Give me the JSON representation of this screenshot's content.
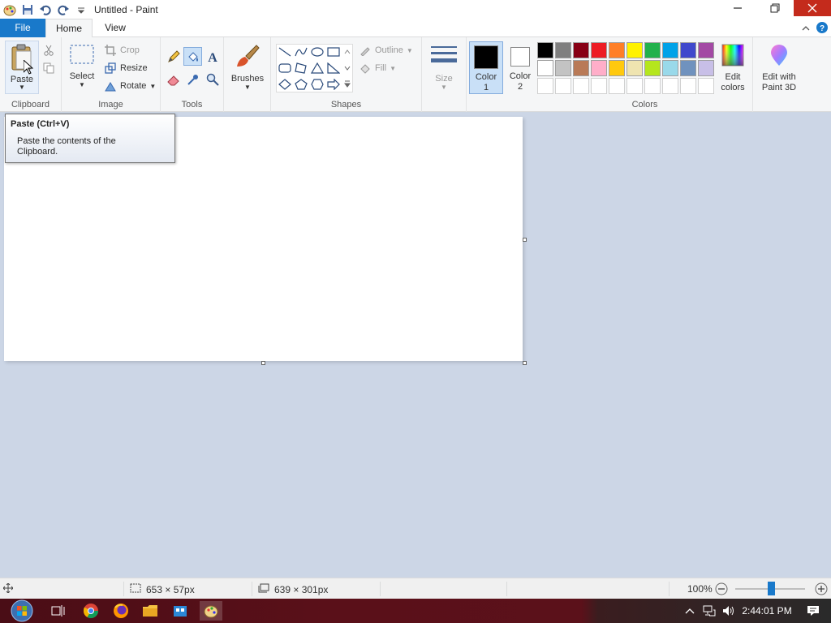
{
  "window": {
    "title": "Untitled - Paint"
  },
  "tabs": {
    "file": "File",
    "home": "Home",
    "view": "View"
  },
  "ribbon": {
    "clipboard": {
      "group_label": "Clipboard",
      "paste": "Paste"
    },
    "image": {
      "group_label": "Image",
      "select": "Select",
      "crop": "Crop",
      "resize": "Resize",
      "rotate": "Rotate"
    },
    "tools": {
      "group_label": "Tools"
    },
    "brushes": {
      "label": "Brushes"
    },
    "shapes": {
      "group_label": "Shapes",
      "outline": "Outline",
      "fill": "Fill"
    },
    "size": {
      "label": "Size"
    },
    "colors": {
      "group_label": "Colors",
      "color1_label": "Color",
      "color1_num": "1",
      "color2_label": "Color",
      "color2_num": "2",
      "color1_value": "#000000",
      "color2_value": "#ffffff",
      "edit_colors_line1": "Edit",
      "edit_colors_line2": "colors",
      "paint3d_line1": "Edit with",
      "paint3d_line2": "Paint 3D",
      "palette_row1": [
        "#000000",
        "#7f7f7f",
        "#880015",
        "#ed1c24",
        "#ff7f27",
        "#fff200",
        "#22b14c",
        "#00a2e8",
        "#3f48cc",
        "#a349a4"
      ],
      "palette_row2": [
        "#ffffff",
        "#c3c3c3",
        "#b97a57",
        "#ffaec9",
        "#ffc90e",
        "#efe4b0",
        "#b5e61d",
        "#99d9ea",
        "#7092be",
        "#c8bfe7"
      ]
    }
  },
  "tooltip": {
    "title": "Paste (Ctrl+V)",
    "desc_line1": "Paste the contents of the",
    "desc_line2": "Clipboard."
  },
  "statusbar": {
    "selection_size": "653 × 57px",
    "canvas_size": "639 × 301px",
    "zoom": "100%"
  },
  "taskbar": {
    "clock": "2:44:01 PM"
  }
}
